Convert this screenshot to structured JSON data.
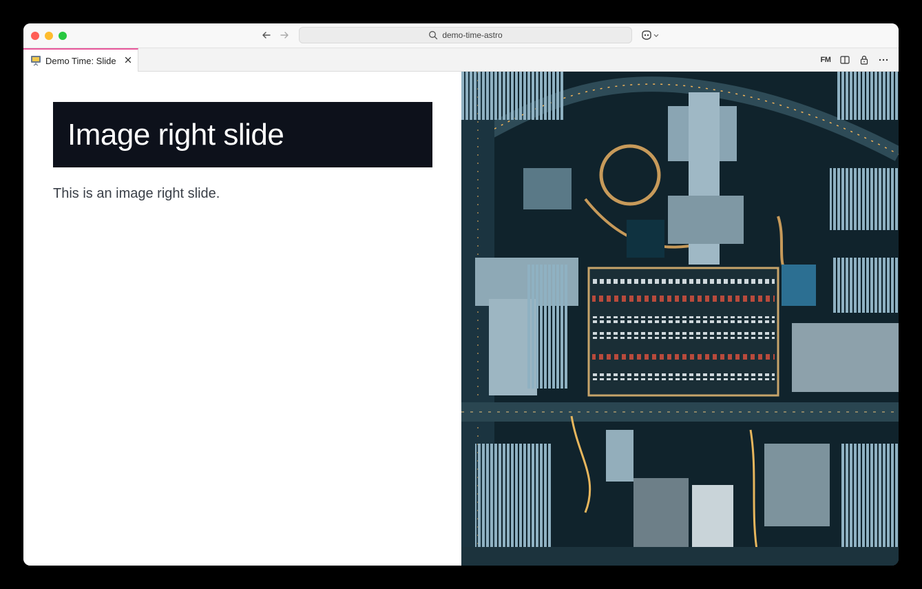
{
  "browser": {
    "address": "demo-time-astro",
    "icons": {
      "back": "arrow-left-icon",
      "forward": "arrow-right-icon",
      "search": "search-icon",
      "assistant": "copilot-icon"
    }
  },
  "tab": {
    "title": "Demo Time: Slide",
    "icon": "slide-presentation-icon",
    "accent": "#e8579b"
  },
  "tab_actions": {
    "front_matter": "FM",
    "icons": [
      "front-matter-icon",
      "split-editor-icon",
      "lock-icon",
      "more-icon"
    ]
  },
  "slide": {
    "title": "Image right slide",
    "body": "This is an image right slide.",
    "title_bg": "#0d111b",
    "image": "aerial-city-parking-lot-photo"
  }
}
